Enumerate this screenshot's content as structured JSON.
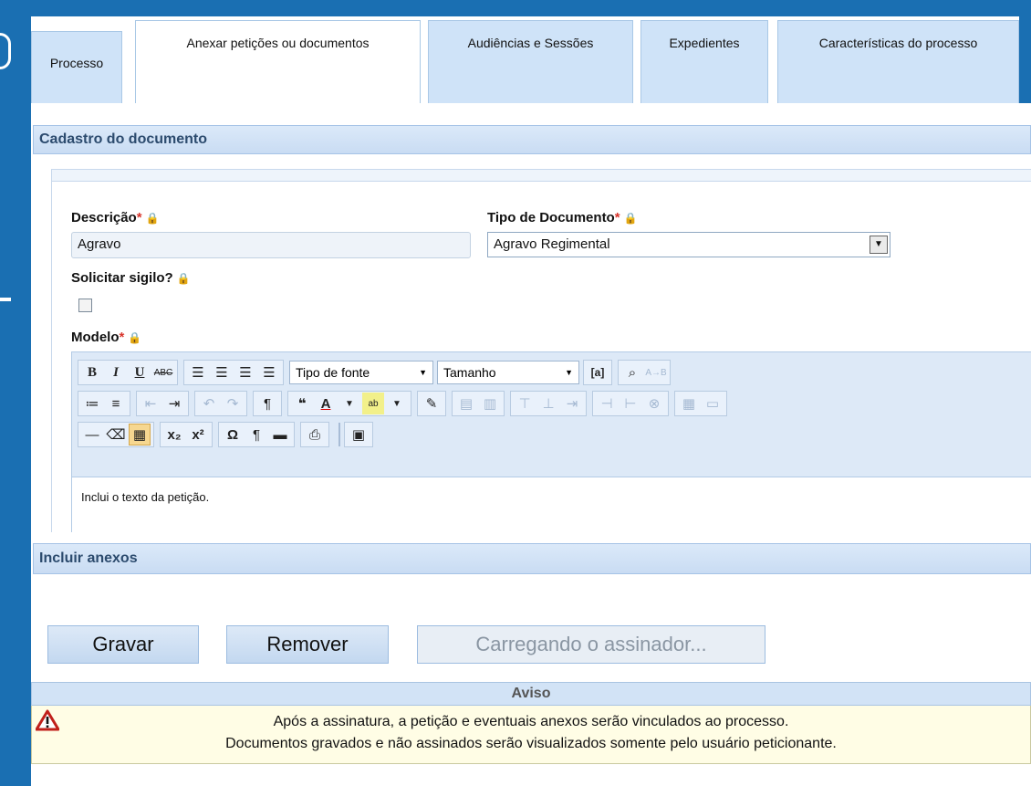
{
  "tabs": [
    {
      "label": "Processo"
    },
    {
      "label": "Anexar petições ou documentos"
    },
    {
      "label": "Audiências e Sessões"
    },
    {
      "label": "Expedientes"
    },
    {
      "label": "Características do processo"
    }
  ],
  "sections": {
    "cadastro": "Cadastro do documento",
    "incluir": "Incluir anexos"
  },
  "form": {
    "descricao_label": "Descrição",
    "descricao_value": "Agravo",
    "tipo_label": "Tipo de Documento",
    "tipo_value": "Agravo Regimental",
    "sigilo_label": "Solicitar sigilo?",
    "modelo_label": "Modelo",
    "required_mark": "*"
  },
  "toolbar": {
    "font_select": "Tipo de fonte",
    "size_select": "Tamanho"
  },
  "editor": {
    "content": "Inclui o texto da petição."
  },
  "actions": {
    "gravar": "Gravar",
    "remover": "Remover",
    "assinador": "Carregando o assinador..."
  },
  "aviso": {
    "title": "Aviso",
    "line1": "Após a assinatura, a petição e eventuais anexos serão vinculados ao processo.",
    "line2": "Documentos gravados e não assinados serão visualizados somente pelo usuário peticionante."
  },
  "colors": {
    "accent": "#1a6fb2",
    "tab_bg": "#cfe3f8",
    "required": "#d8342b",
    "warning_bg": "#fffde5"
  }
}
